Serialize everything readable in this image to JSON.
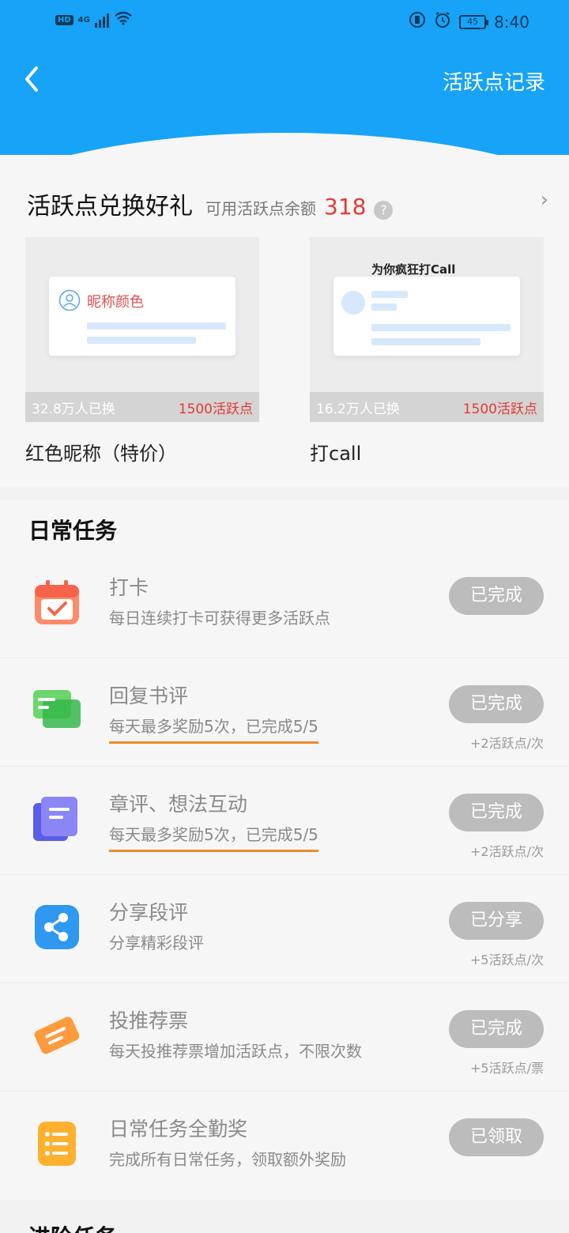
{
  "status_bar": {
    "hd": "HD",
    "network": "4G",
    "battery": "45",
    "time": "8:40"
  },
  "nav": {
    "record_link": "活跃点记录"
  },
  "exchange": {
    "title": "活跃点兑换好礼",
    "balance_label": "可用活跃点余额",
    "balance": "318",
    "prizes": [
      {
        "name": "红色昵称（特价）",
        "preview_text": "昵称颜色",
        "count": "32.8万人已换",
        "cost": "1500活跃点"
      },
      {
        "name": "打call",
        "preview_text": "为你疯狂打Call",
        "count": "16.2万人已换",
        "cost": "1500活跃点"
      }
    ]
  },
  "daily": {
    "title": "日常任务",
    "tasks": [
      {
        "name": "打卡",
        "desc": "每日连续打卡可获得更多活跃点",
        "button": "已完成",
        "reward": "",
        "icon": "calendar-icon"
      },
      {
        "name": "回复书评",
        "desc": "每天最多奖励5次，已完成5/5",
        "button": "已完成",
        "reward": "+2活跃点/次",
        "icon": "chat-icon"
      },
      {
        "name": "章评、想法互动",
        "desc": "每天最多奖励5次，已完成5/5",
        "button": "已完成",
        "reward": "+2活跃点/次",
        "icon": "notes-icon"
      },
      {
        "name": "分享段评",
        "desc": "分享精彩段评",
        "button": "已分享",
        "reward": "+5活跃点/次",
        "icon": "share-icon"
      },
      {
        "name": "投推荐票",
        "desc": "每天投推荐票增加活跃点，不限次数",
        "button": "已完成",
        "reward": "+5活跃点/票",
        "icon": "ticket-icon"
      },
      {
        "name": "日常任务全勤奖",
        "desc": "完成所有日常任务，领取额外奖励",
        "button": "已领取",
        "reward": "",
        "icon": "list-icon"
      }
    ]
  },
  "advanced": {
    "title": "进阶任务"
  },
  "colors": {
    "header": "#16a3f8",
    "accent_red": "#e53935",
    "button_done": "#bcbcbc",
    "highlight_underline": "#f08a2b"
  }
}
